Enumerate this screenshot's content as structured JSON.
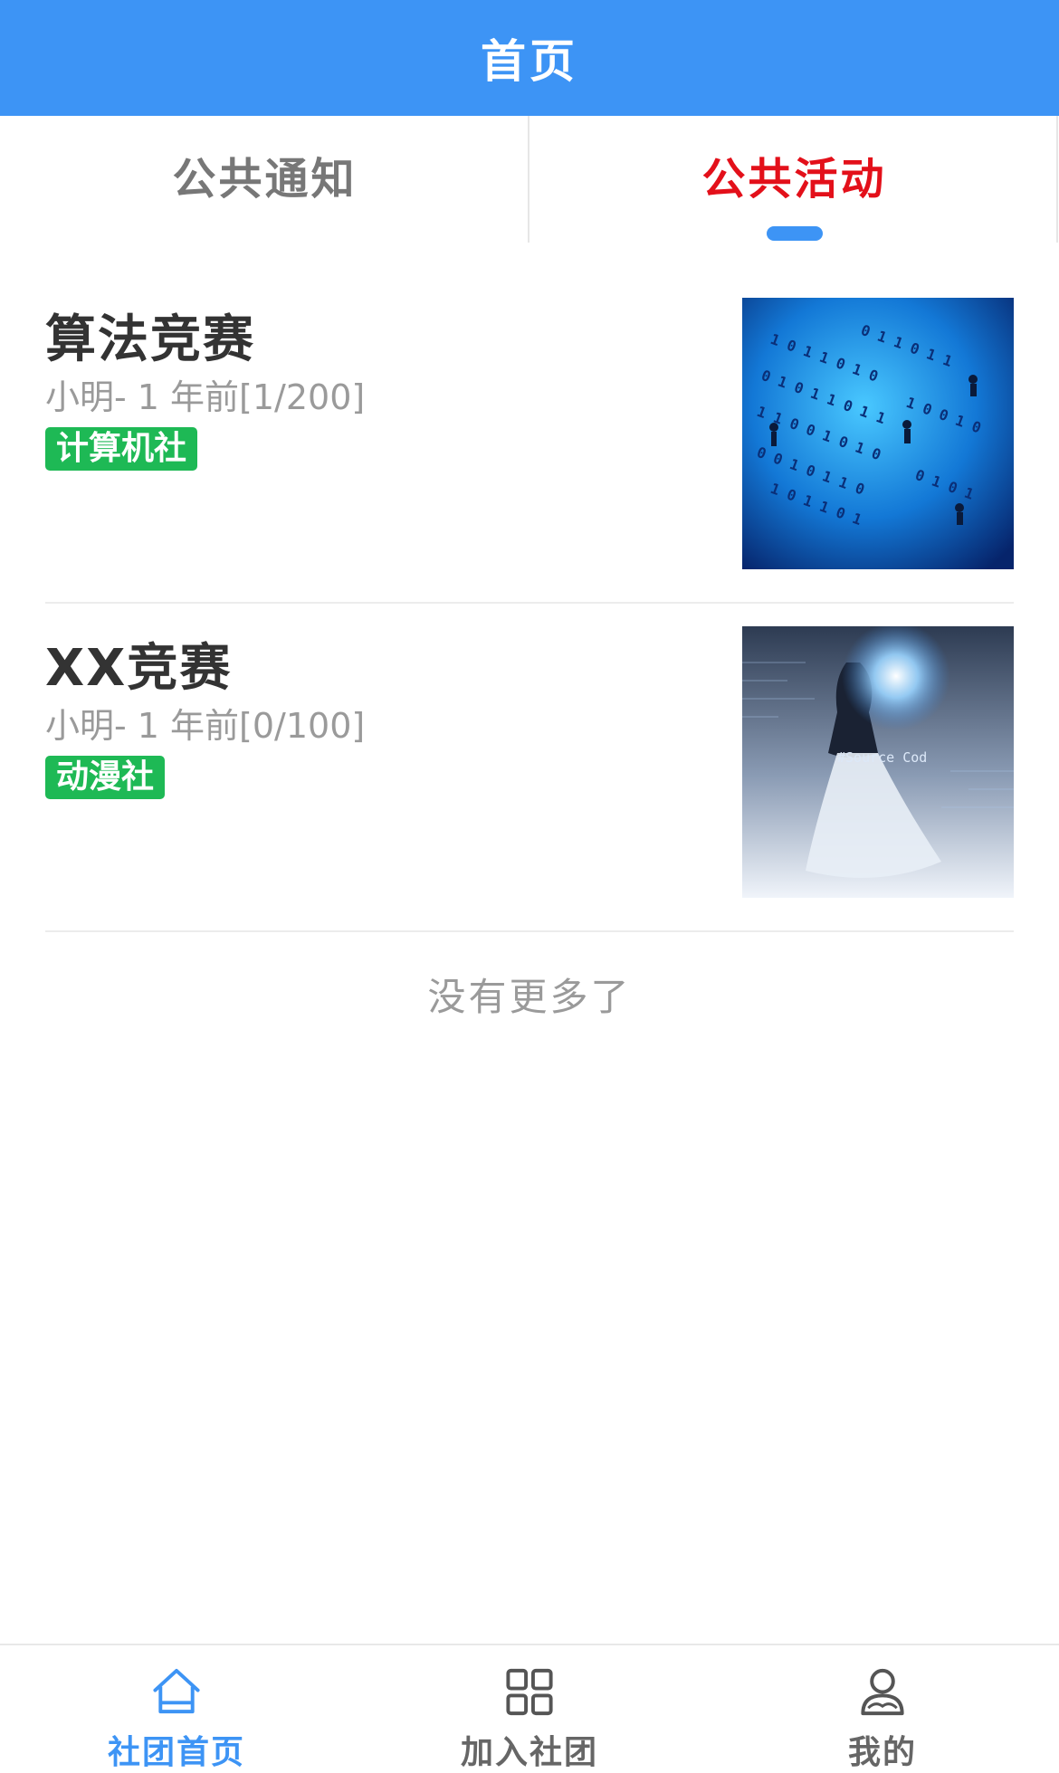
{
  "header": {
    "title": "首页"
  },
  "tabs": [
    {
      "label": "公共通知",
      "active": false
    },
    {
      "label": "公共活动",
      "active": true
    }
  ],
  "colors": {
    "accent": "#3d94f5",
    "active_tab": "#e3101a",
    "tag": "#1eb955"
  },
  "activities": [
    {
      "title": "算法竞赛",
      "meta": "小明- 1 年前[1/200]",
      "tag": "计算机社",
      "image": "binary-code-workers-image"
    },
    {
      "title": "XX竞赛",
      "meta": "小明- 1 年前[0/100]",
      "tag": "动漫社",
      "image": "anime-source-code-image"
    }
  ],
  "list_footer": "没有更多了",
  "tabbar": [
    {
      "label": "社团首页",
      "icon": "home-icon",
      "active": true
    },
    {
      "label": "加入社团",
      "icon": "grid-icon",
      "active": false
    },
    {
      "label": "我的",
      "icon": "user-icon",
      "active": false
    }
  ]
}
